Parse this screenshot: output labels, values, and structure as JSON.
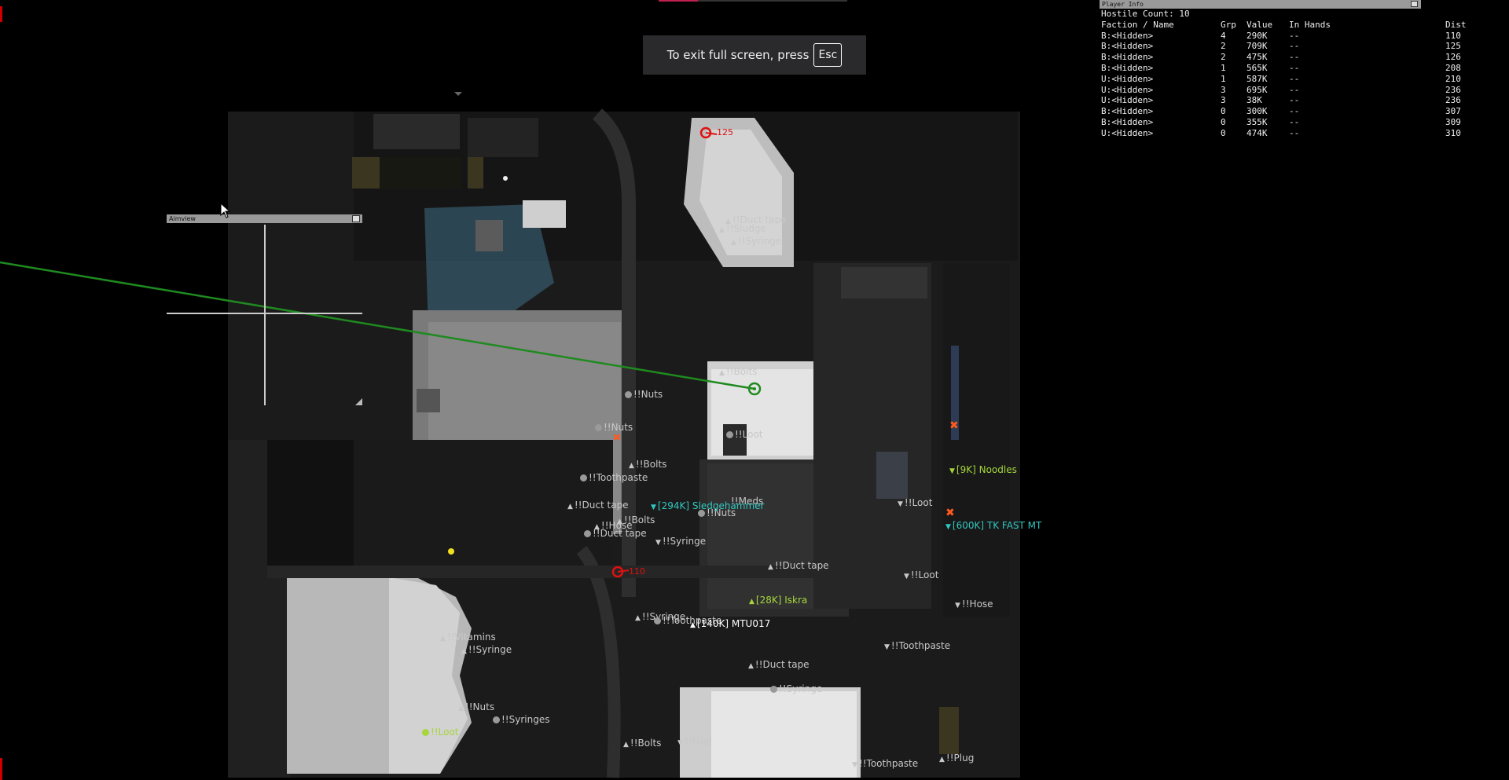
{
  "toast": {
    "text": "To exit full screen, press",
    "key": "Esc"
  },
  "player_info": {
    "panel_title": "Player Info",
    "hostile_count": "Hostile Count: 10",
    "headers": {
      "faction": "Faction / Name",
      "grp": "Grp",
      "value": "Value",
      "hands": "In Hands",
      "dist": "Dist"
    },
    "rows": [
      {
        "name": "B:<Hidden>",
        "grp": "4",
        "value": "290K",
        "hands": "--",
        "dist": "110"
      },
      {
        "name": "B:<Hidden>",
        "grp": "2",
        "value": "709K",
        "hands": "--",
        "dist": "125"
      },
      {
        "name": "B:<Hidden>",
        "grp": "2",
        "value": "475K",
        "hands": "--",
        "dist": "126"
      },
      {
        "name": "B:<Hidden>",
        "grp": "1",
        "value": "565K",
        "hands": "--",
        "dist": "208"
      },
      {
        "name": "U:<Hidden>",
        "grp": "1",
        "value": "587K",
        "hands": "--",
        "dist": "210"
      },
      {
        "name": "U:<Hidden>",
        "grp": "3",
        "value": "695K",
        "hands": "--",
        "dist": "236"
      },
      {
        "name": "U:<Hidden>",
        "grp": "3",
        "value": "38K",
        "hands": "--",
        "dist": "236"
      },
      {
        "name": "B:<Hidden>",
        "grp": "0",
        "value": "300K",
        "hands": "--",
        "dist": "307"
      },
      {
        "name": "B:<Hidden>",
        "grp": "0",
        "value": "355K",
        "hands": "--",
        "dist": "309"
      },
      {
        "name": "U:<Hidden>",
        "grp": "0",
        "value": "474K",
        "hands": "--",
        "dist": "310"
      }
    ]
  },
  "aimview": {
    "title": "Aimview"
  },
  "map_labels": {
    "duct_tape_1": "!!Duct tape",
    "sludge": "!!Sludge",
    "syringe_1": "!!Syringe",
    "bolts_1": "!!Bolts",
    "nuts_1": "!!Nuts",
    "nuts_2": "!!Nuts",
    "loot_1": "!!Loot",
    "bolts_2": "!!Bolts",
    "toothpaste_1": "!!Toothpaste",
    "duct_tape_2": "!!Duct tape",
    "bolts_3": "!!Bolts",
    "hose_1": "!!Hose",
    "duct_tape_3": "!!Duct tape",
    "meds": "!!Meds",
    "nuts_3": "!!Nuts",
    "syringe_2": "!!Syringe",
    "duct_tape_4": "!!Duct tape",
    "loot_2": "!!Loot",
    "loot_3": "!!Loot",
    "hose_2": "!!Hose",
    "syringe_3": "!!Syringe",
    "toothpaste_2": "!!Toothpaste",
    "toothpaste_3": "!!Toothpaste",
    "vitamins": "!!Vitamins",
    "syringe_4": "!!Syringe",
    "duct_tape_5": "!!Duct tape",
    "syringe_5": "!!Syringe",
    "nuts_4": "!!Nuts",
    "syringes": "!!Syringes",
    "loot_4": "!!Loot",
    "bolts_4": "!!Bolts",
    "fuel": "!!Fuel",
    "toothpaste_4": "!!Toothpaste",
    "plug": "!!Plug",
    "bolts_small": "!!Bolts"
  },
  "entities": {
    "noodles": "[9K] Noodles",
    "tk_fast": "[600K] TK FAST MT",
    "sledgehammer": "[294K] Sledgehammer",
    "iskra": "[28K] Iskra",
    "mtu017": "[140K] MTU017",
    "red_dist_1": "110",
    "red_label_top": "125"
  },
  "colors": {
    "hostile_green": "#a6d63c",
    "hostile_cyan": "#31c7c0",
    "player_line": "#1f8a1f",
    "enemy_red": "#e01010"
  }
}
